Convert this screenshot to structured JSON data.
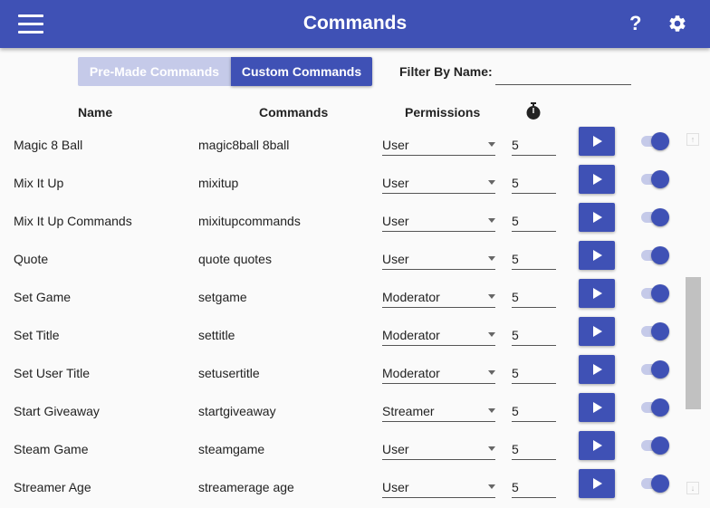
{
  "header": {
    "title": "Commands",
    "help": "?"
  },
  "tabs": {
    "premade": "Pre-Made Commands",
    "custom": "Custom Commands"
  },
  "filter": {
    "label": "Filter By Name:",
    "value": ""
  },
  "columns": {
    "name": "Name",
    "commands": "Commands",
    "permissions": "Permissions"
  },
  "colors": {
    "primary": "#3f51b5",
    "primary_light": "#c5cae9"
  },
  "rows": [
    {
      "name": "Magic 8 Ball",
      "commands": "magic8ball 8ball",
      "permission": "User",
      "cooldown": "5",
      "enabled": true
    },
    {
      "name": "Mix It Up",
      "commands": "mixitup",
      "permission": "User",
      "cooldown": "5",
      "enabled": true
    },
    {
      "name": "Mix It Up Commands",
      "commands": "mixitupcommands",
      "permission": "User",
      "cooldown": "5",
      "enabled": true
    },
    {
      "name": "Quote",
      "commands": "quote quotes",
      "permission": "User",
      "cooldown": "5",
      "enabled": true
    },
    {
      "name": "Set Game",
      "commands": "setgame",
      "permission": "Moderator",
      "cooldown": "5",
      "enabled": true
    },
    {
      "name": "Set Title",
      "commands": "settitle",
      "permission": "Moderator",
      "cooldown": "5",
      "enabled": true
    },
    {
      "name": "Set User Title",
      "commands": "setusertitle",
      "permission": "Moderator",
      "cooldown": "5",
      "enabled": true
    },
    {
      "name": "Start Giveaway",
      "commands": "startgiveaway",
      "permission": "Streamer",
      "cooldown": "5",
      "enabled": true
    },
    {
      "name": "Steam Game",
      "commands": "steamgame",
      "permission": "User",
      "cooldown": "5",
      "enabled": true
    },
    {
      "name": "Streamer Age",
      "commands": "streamerage age",
      "permission": "User",
      "cooldown": "5",
      "enabled": true
    }
  ]
}
